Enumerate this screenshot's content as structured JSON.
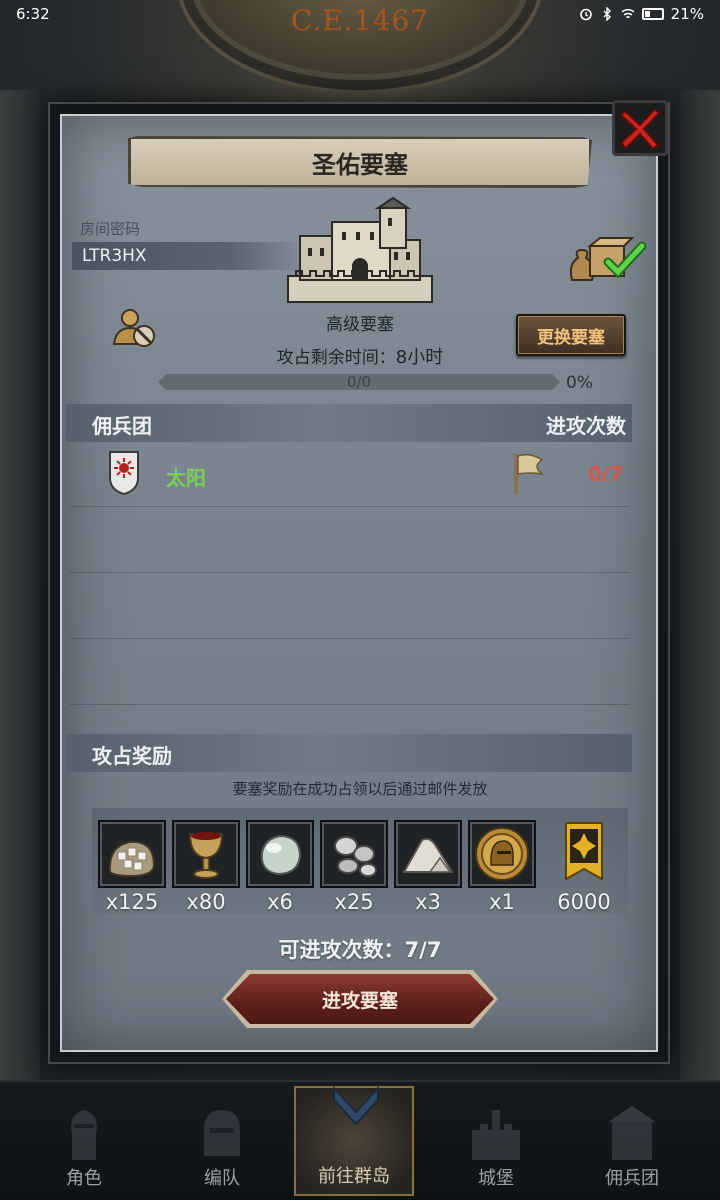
{
  "status_bar": {
    "time": "6:32",
    "battery": "21%"
  },
  "background": {
    "era": "C.E.1467"
  },
  "modal": {
    "title": "圣佑要塞",
    "room_code_label": "房间密码",
    "room_code": "LTR3HX",
    "fort_level": "高级要塞",
    "timer_label": "攻占剩余时间：",
    "timer_value": "8小时",
    "change_button": "更换要塞",
    "progress_text": "0/0",
    "progress_percent": "0%",
    "progress_fraction": 0,
    "mercenary_header": "佣兵团",
    "attacks_header": "进攻次数",
    "mercenaries": [
      {
        "name": "太阳",
        "attacks": "0/7"
      }
    ],
    "rewards_header": "攻占奖励",
    "rewards_note": "要塞奖励在成功占领以后通过邮件发放",
    "rewards": [
      {
        "icon": "sugar-sack-icon",
        "qty": "x125"
      },
      {
        "icon": "goblet-icon",
        "qty": "x80"
      },
      {
        "icon": "pearl-stone-icon",
        "qty": "x6"
      },
      {
        "icon": "silver-ore-icon",
        "qty": "x25"
      },
      {
        "icon": "salt-pile-icon",
        "qty": "x3"
      },
      {
        "icon": "knight-medal-icon",
        "qty": "x1"
      },
      {
        "icon": "banner-emblem-icon",
        "qty": "6000"
      }
    ],
    "attacks_left_label": "可进攻次数：",
    "attacks_left_value": "7/7",
    "attack_button": "进攻要塞"
  },
  "bottom_nav": {
    "items": [
      {
        "label": "角色",
        "active": false
      },
      {
        "label": "编队",
        "active": false
      },
      {
        "label": "前往群岛",
        "active": true
      },
      {
        "label": "城堡",
        "active": false
      },
      {
        "label": "佣兵团",
        "active": false
      }
    ]
  },
  "colors": {
    "accent_green": "#7ad05b",
    "attack_red": "#d7564a",
    "button_gold_text": "#f3c27b"
  }
}
